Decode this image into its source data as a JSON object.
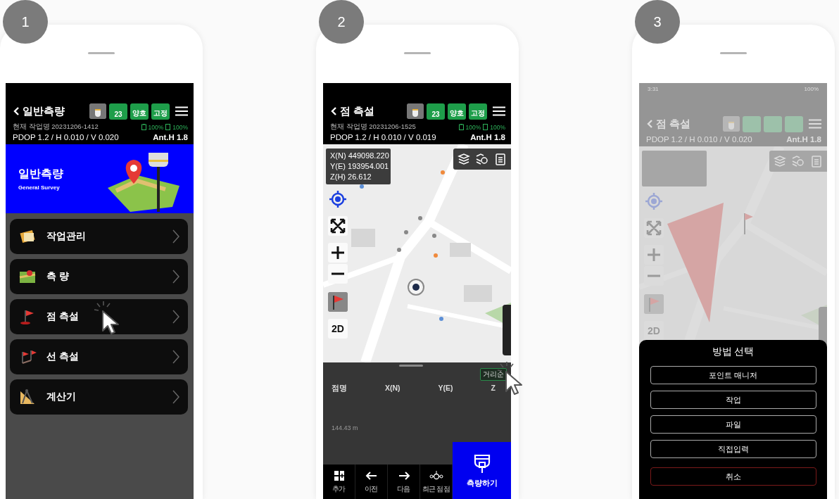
{
  "steps": [
    {
      "number": "1",
      "kind": "menu",
      "header": {
        "title": "일반측량",
        "status_badges": [
          {
            "value": "23"
          },
          {
            "value": "양호"
          },
          {
            "value": "고정"
          }
        ],
        "job": "현재 작업명 20231206-1412",
        "battery_1": "100%",
        "battery_2": "100%",
        "precision": "PDOP 1.2 / H 0.010 / V 0.020",
        "antenna": "Ant.H 1.8"
      },
      "banner": {
        "title": "일반측량",
        "subtitle": "General Survey"
      },
      "menu_items": [
        {
          "label": "작업관리",
          "kind": "jobs",
          "tapped": false
        },
        {
          "label": "측 량",
          "kind": "survey",
          "tapped": false
        },
        {
          "label": "점 측설",
          "kind": "point",
          "tapped": true
        },
        {
          "label": "선 측설",
          "kind": "line",
          "tapped": false
        },
        {
          "label": "계산기",
          "kind": "calc",
          "tapped": false
        }
      ]
    },
    {
      "number": "2",
      "kind": "map",
      "header": {
        "title": "점 측설",
        "status_badges": [
          {
            "value": "23"
          },
          {
            "value": "양호"
          },
          {
            "value": "고정"
          }
        ],
        "job": "현재 작업명 20231206-1525",
        "battery_1": "100%",
        "battery_2": "100%",
        "precision": "PDOP 1.2 / H 0.010 / V 0.019",
        "antenna": "Ant.H 1.8"
      },
      "coordinates": [
        "X(N) 449098.220",
        "Y(E) 193954.001",
        "Z(H) 26.612"
      ],
      "map_mode": "2D",
      "panel": {
        "sort_button": {
          "label": "거리순",
          "tapped": true
        },
        "columns": [
          "점명",
          "X(N)",
          "Y(E)",
          "Z"
        ],
        "scale": "144.43 m"
      },
      "toolbar": [
        {
          "label": "추가",
          "kind": "add"
        },
        {
          "label": "이전",
          "kind": "prev"
        },
        {
          "label": "다음",
          "kind": "next"
        },
        {
          "label": "최근 점점",
          "kind": "recent"
        }
      ],
      "measure_button": "측량하기"
    },
    {
      "number": "3",
      "kind": "dialog",
      "status_bar": {
        "time": "3:31",
        "battery": "100%"
      },
      "header": {
        "title": "점 측설",
        "precision": "PDOP 1.2 / H 0.010 / V 0.020",
        "antenna": "Ant.H 1.8"
      },
      "map_mode": "2D",
      "dialog": {
        "title": "방법 선택",
        "options": [
          {
            "label": "포인트 매니저",
            "kind": "option"
          },
          {
            "label": "작업",
            "kind": "option"
          },
          {
            "label": "파일",
            "kind": "option"
          },
          {
            "label": "직접입력",
            "kind": "option"
          },
          {
            "label": "취소",
            "kind": "cancel"
          }
        ]
      }
    }
  ]
}
